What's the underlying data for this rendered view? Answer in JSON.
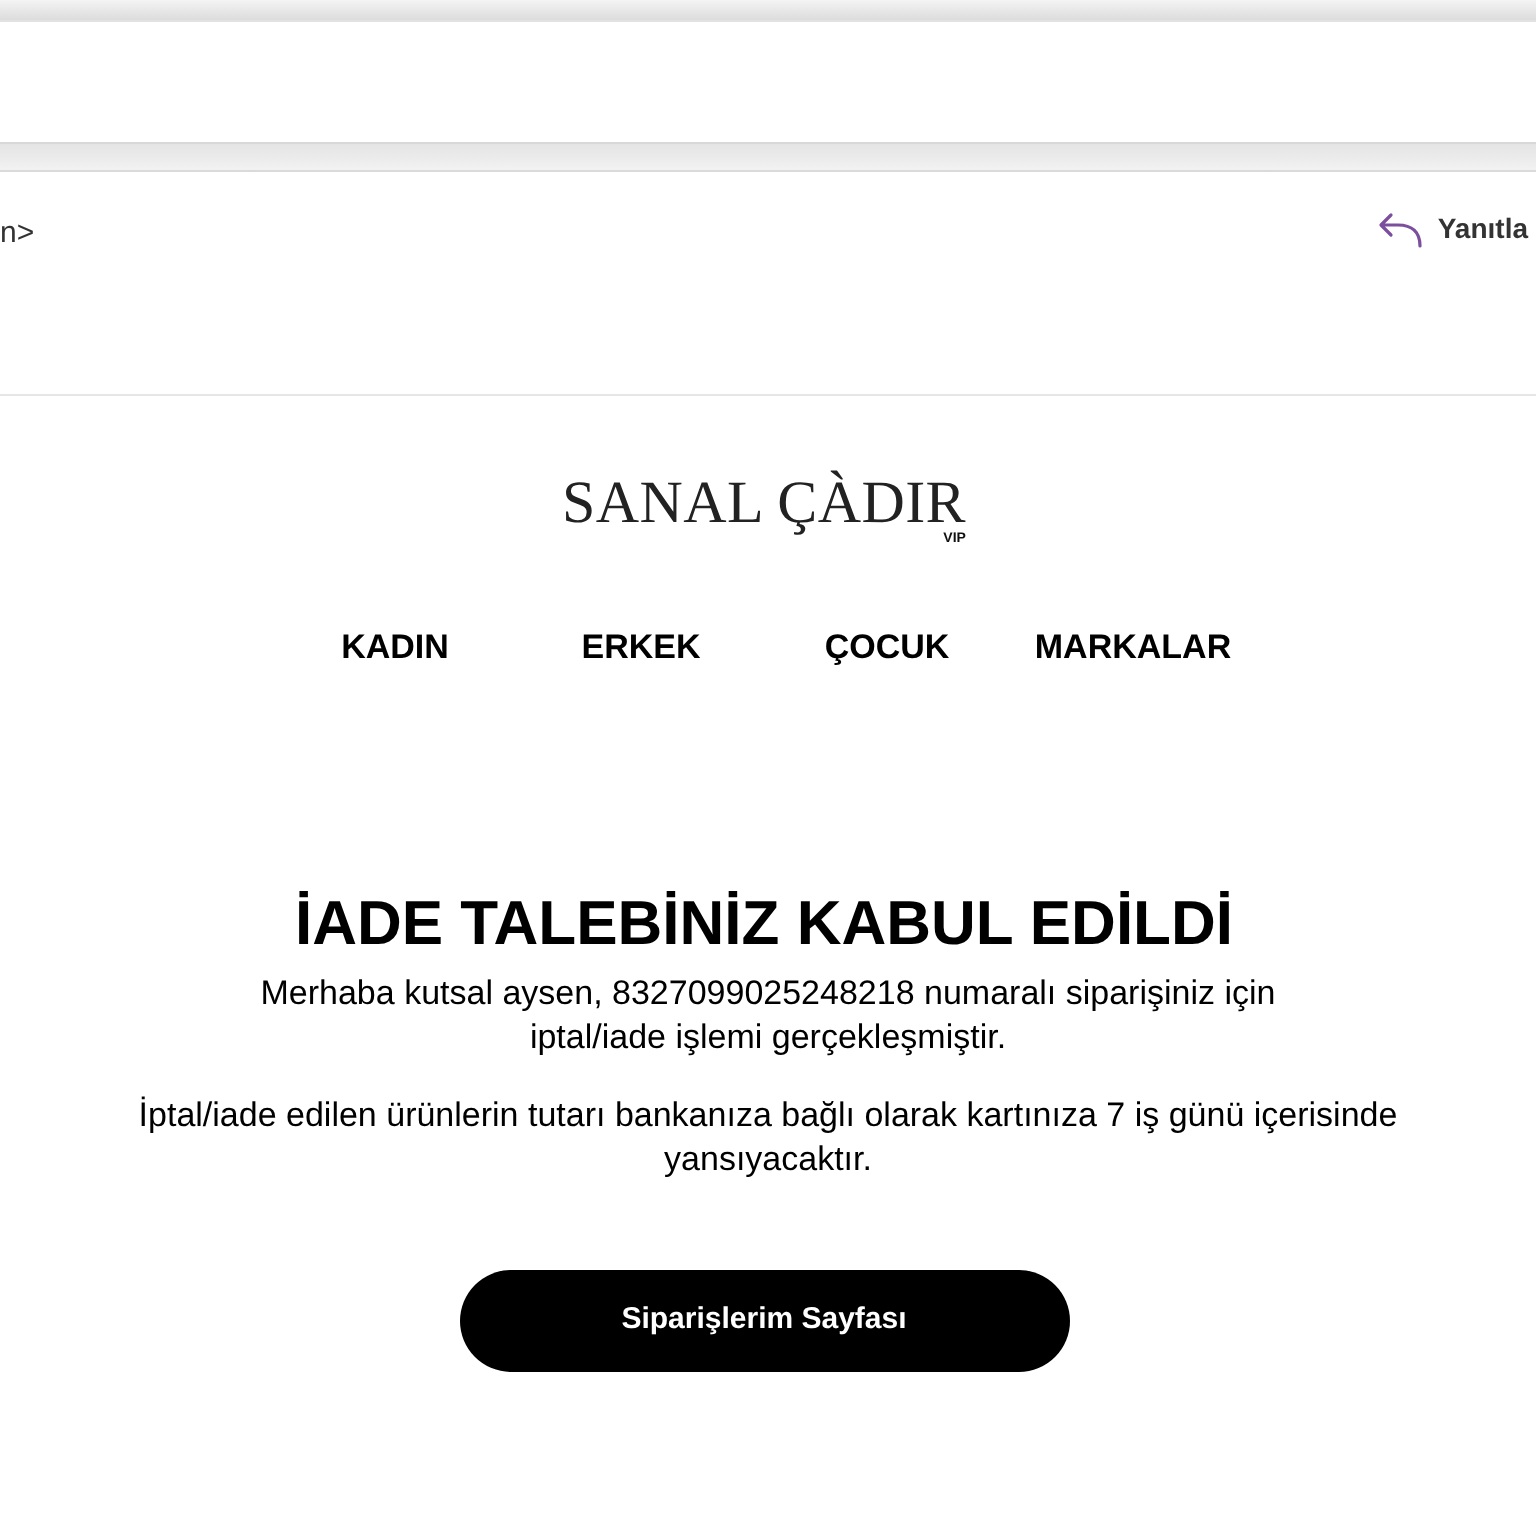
{
  "message_header": {
    "sender_fragment": "n>",
    "reply_button": {
      "label": "Yanıtla"
    }
  },
  "email": {
    "logo": {
      "name": "SANAL ÇÀDIR",
      "tag": "VIP"
    },
    "nav": [
      {
        "label": "KADIN"
      },
      {
        "label": "ERKEK"
      },
      {
        "label": "ÇOCUK"
      },
      {
        "label": "MARKALAR"
      }
    ],
    "title": "İADE TALEBİNİZ KABUL EDİLDİ",
    "paragraphs": [
      {
        "text": "Merhaba kutsal aysen, 8327099025248218 numaralı siparişiniz için iptal/iade işlemi gerçekleşmiştir.",
        "kind": "narrow"
      },
      {
        "text": "İptal/iade edilen ürünlerin tutarı bankanıza bağlı olarak kartınıza 7 iş günü içerisinde yansıyacaktır.",
        "kind": "wide"
      }
    ],
    "button": {
      "label": "Siparişlerim Sayfası"
    }
  }
}
